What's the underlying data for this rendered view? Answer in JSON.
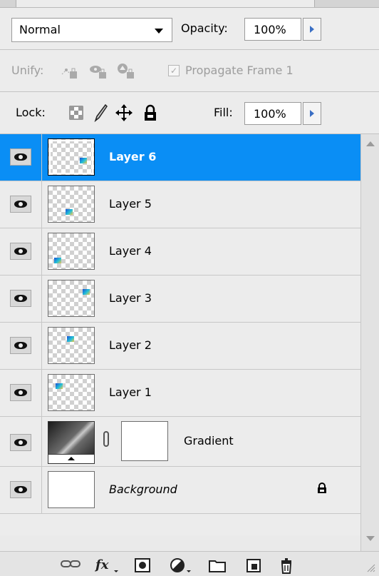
{
  "toolbar": {
    "blend_mode": "Normal",
    "opacity_label": "Opacity:",
    "opacity_value": "100%",
    "unify_label": "Unify:",
    "propagate_label": "Propagate Frame 1",
    "propagate_checked": true,
    "lock_label": "Lock:",
    "fill_label": "Fill:",
    "fill_value": "100%"
  },
  "layers": [
    {
      "name": "Layer 6",
      "selected": true,
      "visible": true
    },
    {
      "name": "Layer 5",
      "selected": false,
      "visible": true
    },
    {
      "name": "Layer 4",
      "selected": false,
      "visible": true
    },
    {
      "name": "Layer 3",
      "selected": false,
      "visible": true
    },
    {
      "name": "Layer 2",
      "selected": false,
      "visible": true
    },
    {
      "name": "Layer 1",
      "selected": false,
      "visible": true
    },
    {
      "name": "Gradient",
      "selected": false,
      "visible": true,
      "type": "gradient-fill-with-mask"
    },
    {
      "name": "Background",
      "selected": false,
      "visible": true,
      "locked": true
    }
  ],
  "icons": {
    "eye": "eye-icon",
    "chain": "link-icon",
    "lock": "lock-icon",
    "bottom": [
      "link-layers-icon",
      "fx-icon",
      "add-mask-icon",
      "adjustment-layer-icon",
      "new-group-icon",
      "new-layer-icon",
      "delete-layer-icon"
    ]
  },
  "colors": {
    "selection": "#0a8ef5",
    "panel_bg": "#ececec",
    "stepper_arrow": "#3a6fc4"
  }
}
